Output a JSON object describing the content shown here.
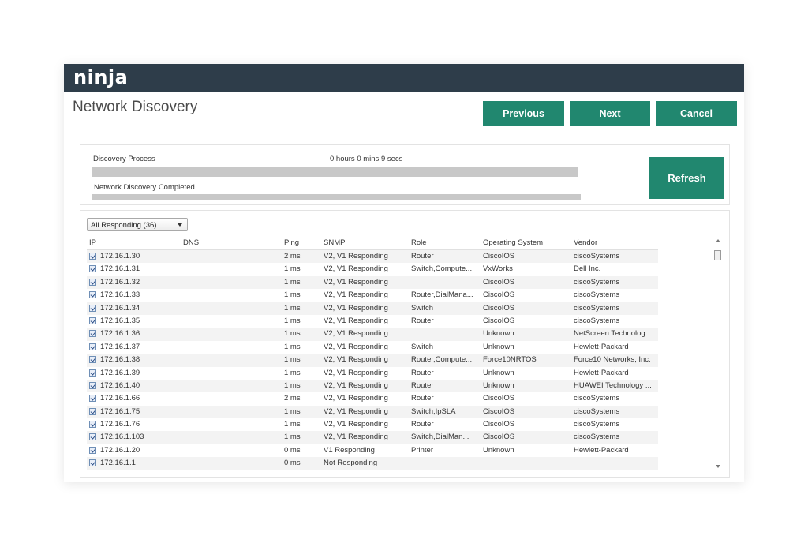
{
  "header": {
    "logo": "ninja"
  },
  "page": {
    "title": "Network Discovery"
  },
  "toolbar": {
    "previous_label": "Previous",
    "next_label": "Next",
    "cancel_label": "Cancel"
  },
  "discovery": {
    "process_label": "Discovery Process",
    "elapsed": "0 hours 0 mins 9 secs",
    "progress": 1.0,
    "status": "Network Discovery Completed.",
    "refresh_label": "Refresh"
  },
  "filter": {
    "selected": "All Responding (36)"
  },
  "table": {
    "columns": {
      "ip": "IP",
      "dns": "DNS",
      "ping": "Ping",
      "snmp": "SNMP",
      "role": "Role",
      "os": "Operating System",
      "vendor": "Vendor"
    },
    "rows": [
      {
        "checked": true,
        "ip": "172.16.1.30",
        "dns": "",
        "ping": "2 ms",
        "snmp": "V2, V1 Responding",
        "role": "Router",
        "os": "CiscoIOS",
        "vendor": "ciscoSystems"
      },
      {
        "checked": true,
        "ip": "172.16.1.31",
        "dns": "",
        "ping": "1 ms",
        "snmp": "V2, V1 Responding",
        "role": "Switch,Compute...",
        "os": "VxWorks",
        "vendor": "Dell Inc."
      },
      {
        "checked": true,
        "ip": "172.16.1.32",
        "dns": "",
        "ping": "1 ms",
        "snmp": "V2, V1 Responding",
        "role": "",
        "os": "CiscoIOS",
        "vendor": "ciscoSystems"
      },
      {
        "checked": true,
        "ip": "172.16.1.33",
        "dns": "",
        "ping": "1 ms",
        "snmp": "V2, V1 Responding",
        "role": "Router,DialMana...",
        "os": "CiscoIOS",
        "vendor": "ciscoSystems"
      },
      {
        "checked": true,
        "ip": "172.16.1.34",
        "dns": "",
        "ping": "1 ms",
        "snmp": "V2, V1 Responding",
        "role": "Switch",
        "os": "CiscoIOS",
        "vendor": "ciscoSystems"
      },
      {
        "checked": true,
        "ip": "172.16.1.35",
        "dns": "",
        "ping": "1 ms",
        "snmp": "V2, V1 Responding",
        "role": "Router",
        "os": "CiscoIOS",
        "vendor": "ciscoSystems"
      },
      {
        "checked": true,
        "ip": "172.16.1.36",
        "dns": "",
        "ping": "1 ms",
        "snmp": "V2, V1 Responding",
        "role": "",
        "os": "Unknown",
        "vendor": "NetScreen Technolog..."
      },
      {
        "checked": true,
        "ip": "172.16.1.37",
        "dns": "",
        "ping": "1 ms",
        "snmp": "V2, V1 Responding",
        "role": "Switch",
        "os": "Unknown",
        "vendor": "Hewlett-Packard"
      },
      {
        "checked": true,
        "ip": "172.16.1.38",
        "dns": "",
        "ping": "1 ms",
        "snmp": "V2, V1 Responding",
        "role": "Router,Compute...",
        "os": "Force10NRTOS",
        "vendor": "Force10 Networks, Inc."
      },
      {
        "checked": true,
        "ip": "172.16.1.39",
        "dns": "",
        "ping": "1 ms",
        "snmp": "V2, V1 Responding",
        "role": "Router",
        "os": "Unknown",
        "vendor": "Hewlett-Packard"
      },
      {
        "checked": true,
        "ip": "172.16.1.40",
        "dns": "",
        "ping": "1 ms",
        "snmp": "V2, V1 Responding",
        "role": "Router",
        "os": "Unknown",
        "vendor": "HUAWEI Technology ..."
      },
      {
        "checked": true,
        "ip": "172.16.1.66",
        "dns": "",
        "ping": "2 ms",
        "snmp": "V2, V1 Responding",
        "role": "Router",
        "os": "CiscoIOS",
        "vendor": "ciscoSystems"
      },
      {
        "checked": true,
        "ip": "172.16.1.75",
        "dns": "",
        "ping": "1 ms",
        "snmp": "V2, V1 Responding",
        "role": "Switch,IpSLA",
        "os": "CiscoIOS",
        "vendor": "ciscoSystems"
      },
      {
        "checked": true,
        "ip": "172.16.1.76",
        "dns": "",
        "ping": "1 ms",
        "snmp": "V2, V1 Responding",
        "role": "Router",
        "os": "CiscoIOS",
        "vendor": "ciscoSystems"
      },
      {
        "checked": true,
        "ip": "172.16.1.103",
        "dns": "",
        "ping": "1 ms",
        "snmp": "V2, V1 Responding",
        "role": "Switch,DialMan...",
        "os": "CiscoIOS",
        "vendor": "ciscoSystems"
      },
      {
        "checked": true,
        "ip": "172.16.1.20",
        "dns": "",
        "ping": "0 ms",
        "snmp": "V1 Responding",
        "role": "Printer",
        "os": "Unknown",
        "vendor": "Hewlett-Packard"
      },
      {
        "checked": true,
        "ip": "172.16.1.1",
        "dns": "",
        "ping": "0 ms",
        "snmp": "Not Responding",
        "role": "",
        "os": "",
        "vendor": ""
      }
    ]
  }
}
